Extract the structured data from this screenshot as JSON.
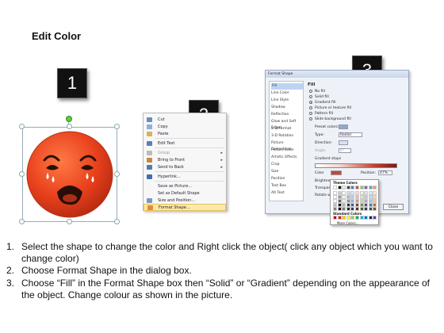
{
  "title": "Edit Color",
  "steps": [
    "1",
    "2",
    "3"
  ],
  "context_menu": {
    "items": [
      {
        "label": "Cut",
        "icon": "scissors-icon",
        "has_submenu": false,
        "disabled": false
      },
      {
        "label": "Copy",
        "icon": "copy-icon",
        "has_submenu": false,
        "disabled": false
      },
      {
        "label": "Paste",
        "icon": "paste-icon",
        "has_submenu": false,
        "disabled": false
      },
      {
        "label": "Edit Text",
        "icon": "edit-text-icon",
        "has_submenu": false,
        "disabled": false
      },
      {
        "label": "Group",
        "icon": "group-icon",
        "has_submenu": true,
        "disabled": true
      },
      {
        "label": "Bring to Front",
        "icon": "bring-front-icon",
        "has_submenu": true,
        "disabled": false
      },
      {
        "label": "Send to Back",
        "icon": "send-back-icon",
        "has_submenu": true,
        "disabled": false
      },
      {
        "label": "Hyperlink...",
        "icon": "hyperlink-icon",
        "has_submenu": false,
        "disabled": false
      },
      {
        "label": "Save as Picture...",
        "icon": "",
        "has_submenu": false,
        "disabled": false
      },
      {
        "label": "Set as Default Shape",
        "icon": "",
        "has_submenu": false,
        "disabled": false
      },
      {
        "label": "Size and Position...",
        "icon": "size-position-icon",
        "has_submenu": false,
        "disabled": false
      },
      {
        "label": "Format Shape...",
        "icon": "format-shape-icon",
        "has_submenu": false,
        "disabled": false,
        "highlighted": true
      }
    ]
  },
  "format_dialog": {
    "title": "Format Shape",
    "nav": [
      "Fill",
      "Line Color",
      "Line Style",
      "Shadow",
      "Reflection",
      "Glow and Soft Edges",
      "3-D Format",
      "3-D Rotation",
      "Picture Corrections",
      "Picture Color",
      "Artistic Effects",
      "Crop",
      "Size",
      "Position",
      "Text Box",
      "Alt Text"
    ],
    "section": "Fill",
    "fill_options": [
      "No fill",
      "Solid fill",
      "Gradient fill",
      "Picture or texture fill",
      "Pattern fill",
      "Slide background fill"
    ],
    "selected_fill": "Gradient fill",
    "preset_colors_label": "Preset colors:",
    "type_label": "Type:",
    "type_value": "Radial",
    "direction_label": "Direction:",
    "angle_label": "Angle:",
    "angle_value": "0°",
    "gradient_stops_label": "Gradient stops",
    "color_label": "Color",
    "position_label": "Position:",
    "position_value": "47%",
    "brightness_label": "Brightness:",
    "transparency_label": "Transparency:",
    "rotate_label": "Rotate with shape",
    "close_label": "Close"
  },
  "palette": {
    "theme_label": "Theme Colors",
    "standard_label": "Standard Colors",
    "more_label": "More Colors...",
    "theme_colors": [
      "#ffffff",
      "#000000",
      "#eeece1",
      "#1f497d",
      "#4f81bd",
      "#c0504d",
      "#9bbb59",
      "#8064a2",
      "#4bacc6",
      "#f79646"
    ],
    "standard_colors": [
      "#c00000",
      "#ff0000",
      "#ffc000",
      "#ffff00",
      "#92d050",
      "#00b050",
      "#00b0f0",
      "#0070c0",
      "#002060",
      "#7030a0"
    ]
  },
  "instructions": [
    {
      "num": "1.",
      "text": "Select the shape to change the color and Right click the object( click any object which you want to change color)"
    },
    {
      "num": "2.",
      "text": "Choose Format Shape in the dialog box."
    },
    {
      "num": "3.",
      "text": "Choose “Fill” in the Format Shape box then “Solid” or “Gradient” depending on the appearance of the object. Change colour as shown in the picture."
    }
  ],
  "colors": {
    "emoji_face": "#e8401c",
    "badge": "#111111",
    "menu_highlight": "#fde9a8"
  }
}
